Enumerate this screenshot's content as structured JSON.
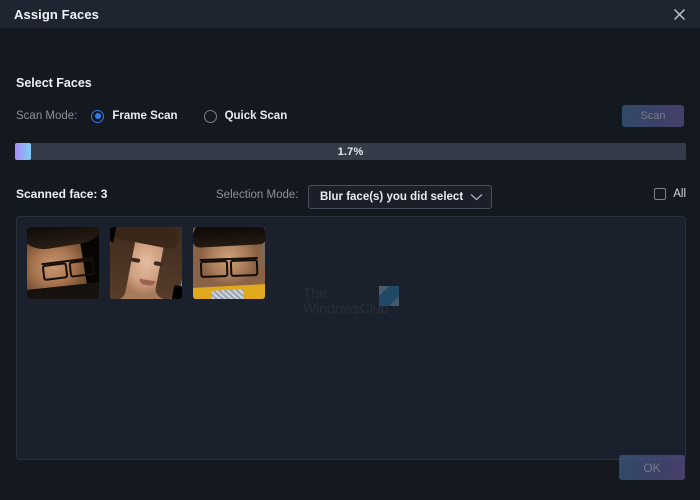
{
  "window": {
    "title": "Assign Faces",
    "close_icon": "close-icon"
  },
  "section": {
    "heading": "Select Faces"
  },
  "scan_mode": {
    "label": "Scan Mode:",
    "options": [
      {
        "label": "Frame Scan",
        "selected": true
      },
      {
        "label": "Quick Scan",
        "selected": false
      }
    ]
  },
  "scan_button": {
    "label": "Scan",
    "enabled": false
  },
  "progress": {
    "percent_text": "1.7%",
    "value": 1.7,
    "fill_start_color": "#a98bf5",
    "fill_end_color": "#7ed0f7",
    "track_color": "#343b49"
  },
  "scanned": {
    "count_label": "Scanned face: 3",
    "count": 3
  },
  "selection_mode": {
    "label": "Selection Mode:",
    "value": "Blur face(s) you did select",
    "chevron_icon": "chevron-down-icon"
  },
  "all_checkbox": {
    "label": "All",
    "checked": false
  },
  "faces": [
    {
      "name": "face-thumbnail-1",
      "description": "man with glasses looking down"
    },
    {
      "name": "face-thumbnail-2",
      "description": "young woman with long hair smiling"
    },
    {
      "name": "face-thumbnail-3",
      "description": "man with glasses in yellow jacket"
    }
  ],
  "watermark": {
    "line1": "The",
    "line2": "WindowsClub"
  },
  "ok_button": {
    "label": "OK",
    "enabled": false
  }
}
